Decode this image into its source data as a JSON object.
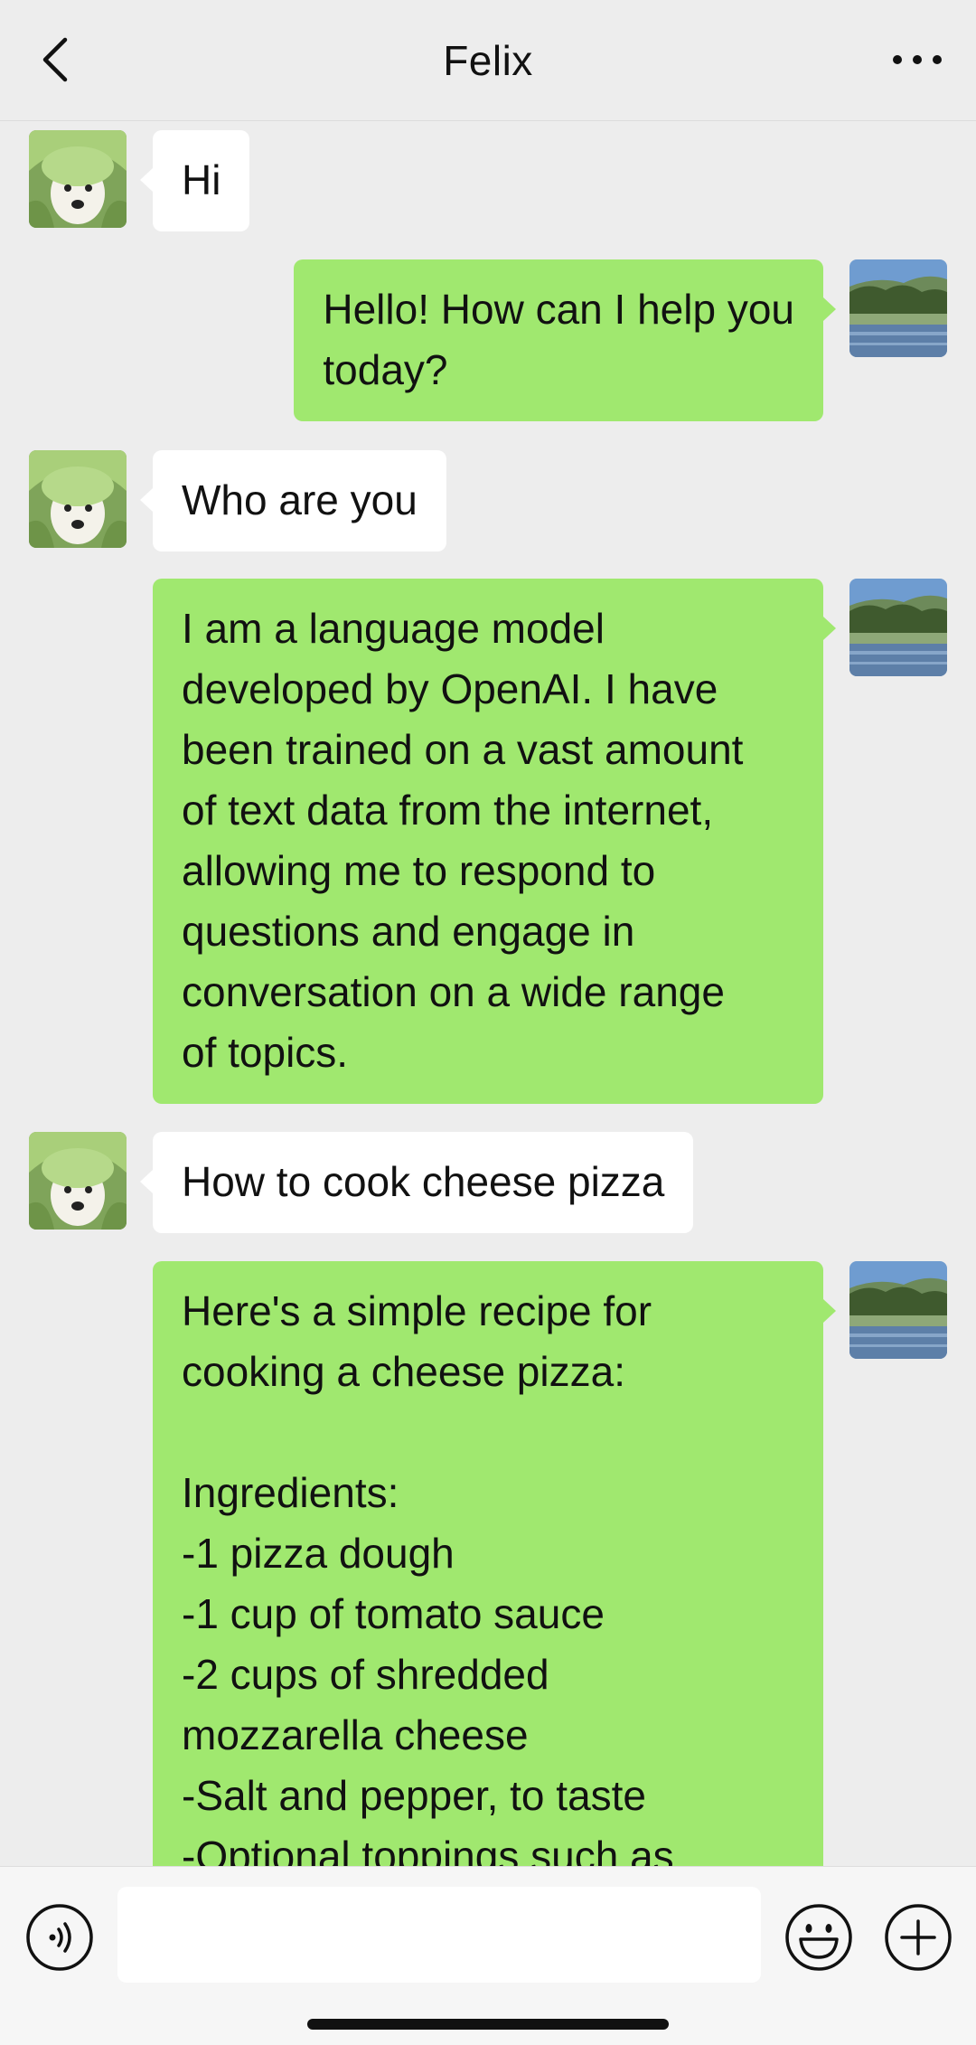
{
  "header": {
    "title": "Felix",
    "back_icon": "chevron-left-icon",
    "more_icon": "more-horizontal-icon"
  },
  "messages": [
    {
      "side": "in",
      "text": "Hi"
    },
    {
      "side": "out",
      "text": "Hello! How can I help you\ntoday?"
    },
    {
      "side": "in",
      "text": "Who are you"
    },
    {
      "side": "out",
      "text": "I am a language model\ndeveloped by OpenAI. I have\nbeen trained on a vast amount\nof text data from the internet,\nallowing me to respond to\nquestions and engage in\nconversation on a wide range\nof topics."
    },
    {
      "side": "in",
      "text": "How to cook cheese pizza"
    },
    {
      "side": "out",
      "text": "Here's a simple recipe for\ncooking a cheese pizza:\n\nIngredients:\n-1 pizza dough\n-1 cup of tomato sauce\n-2 cups of shredded\nmozzarella cheese\n-Salt and pepper, to taste\n-Optional toppings such as"
    }
  ],
  "input_bar": {
    "placeholder": "",
    "voice_icon": "voice-icon",
    "emoji_icon": "emoji-icon",
    "plus_icon": "plus-icon"
  },
  "colors": {
    "background": "#ededed",
    "incoming_bubble": "#ffffff",
    "outgoing_bubble": "#a0e86f"
  }
}
